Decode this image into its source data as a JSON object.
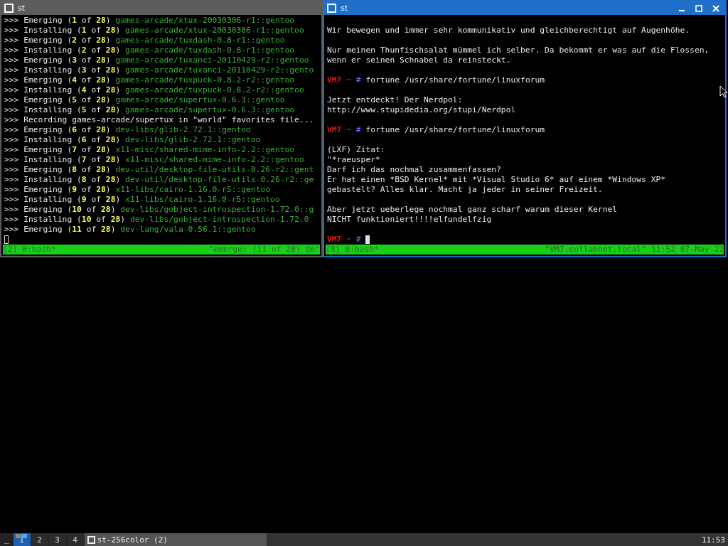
{
  "windows": [
    {
      "title": "st",
      "focused": false,
      "lines": [
        {
          "kind": "emerge",
          "parts": [
            {
              "kind": "plain",
              "text": ">>> Emerging ("
            },
            {
              "kind": "number",
              "text": "1"
            },
            {
              "kind": "plain",
              "text": " of "
            },
            {
              "kind": "number",
              "text": "28"
            },
            {
              "kind": "plain",
              "text": ") "
            },
            {
              "kind": "package",
              "text": "games-arcade/xtux-20030306-r1::gentoo"
            }
          ]
        },
        {
          "kind": "emerge",
          "parts": [
            {
              "kind": "plain",
              "text": ">>> Installing ("
            },
            {
              "kind": "number",
              "text": "1"
            },
            {
              "kind": "plain",
              "text": " of "
            },
            {
              "kind": "number",
              "text": "28"
            },
            {
              "kind": "plain",
              "text": ") "
            },
            {
              "kind": "package",
              "text": "games-arcade/xtux-20030306-r1::gentoo"
            }
          ]
        },
        {
          "kind": "emerge",
          "parts": [
            {
              "kind": "plain",
              "text": ">>> Emerging ("
            },
            {
              "kind": "number",
              "text": "2"
            },
            {
              "kind": "plain",
              "text": " of "
            },
            {
              "kind": "number",
              "text": "28"
            },
            {
              "kind": "plain",
              "text": ") "
            },
            {
              "kind": "package",
              "text": "games-arcade/tuxdash-0.8-r1::gentoo"
            }
          ]
        },
        {
          "kind": "emerge",
          "parts": [
            {
              "kind": "plain",
              "text": ">>> Installing ("
            },
            {
              "kind": "number",
              "text": "2"
            },
            {
              "kind": "plain",
              "text": " of "
            },
            {
              "kind": "number",
              "text": "28"
            },
            {
              "kind": "plain",
              "text": ") "
            },
            {
              "kind": "package",
              "text": "games-arcade/tuxdash-0.8-r1::gentoo"
            }
          ]
        },
        {
          "kind": "emerge",
          "parts": [
            {
              "kind": "plain",
              "text": ">>> Emerging ("
            },
            {
              "kind": "number",
              "text": "3"
            },
            {
              "kind": "plain",
              "text": " of "
            },
            {
              "kind": "number",
              "text": "28"
            },
            {
              "kind": "plain",
              "text": ") "
            },
            {
              "kind": "package",
              "text": "games-arcade/tuxanci-20110429-r2::gentoo"
            }
          ]
        },
        {
          "kind": "emerge",
          "parts": [
            {
              "kind": "plain",
              "text": ">>> Installing ("
            },
            {
              "kind": "number",
              "text": "3"
            },
            {
              "kind": "plain",
              "text": " of "
            },
            {
              "kind": "number",
              "text": "28"
            },
            {
              "kind": "plain",
              "text": ") "
            },
            {
              "kind": "package",
              "text": "games-arcade/tuxanci-20110429-r2::gento"
            }
          ]
        },
        {
          "kind": "emerge",
          "parts": [
            {
              "kind": "plain",
              "text": ">>> Emerging ("
            },
            {
              "kind": "number",
              "text": "4"
            },
            {
              "kind": "plain",
              "text": " of "
            },
            {
              "kind": "number",
              "text": "28"
            },
            {
              "kind": "plain",
              "text": ") "
            },
            {
              "kind": "package",
              "text": "games-arcade/tuxpuck-0.8.2-r2::gentoo"
            }
          ]
        },
        {
          "kind": "emerge",
          "parts": [
            {
              "kind": "plain",
              "text": ">>> Installing ("
            },
            {
              "kind": "number",
              "text": "4"
            },
            {
              "kind": "plain",
              "text": " of "
            },
            {
              "kind": "number",
              "text": "28"
            },
            {
              "kind": "plain",
              "text": ") "
            },
            {
              "kind": "package",
              "text": "games-arcade/tuxpuck-0.8.2-r2::gentoo"
            }
          ]
        },
        {
          "kind": "emerge",
          "parts": [
            {
              "kind": "plain",
              "text": ">>> Emerging ("
            },
            {
              "kind": "number",
              "text": "5"
            },
            {
              "kind": "plain",
              "text": " of "
            },
            {
              "kind": "number",
              "text": "28"
            },
            {
              "kind": "plain",
              "text": ") "
            },
            {
              "kind": "package",
              "text": "games-arcade/supertux-0.6.3::gentoo"
            }
          ]
        },
        {
          "kind": "emerge",
          "parts": [
            {
              "kind": "plain",
              "text": ">>> Installing ("
            },
            {
              "kind": "number",
              "text": "5"
            },
            {
              "kind": "plain",
              "text": " of "
            },
            {
              "kind": "number",
              "text": "28"
            },
            {
              "kind": "plain",
              "text": ") "
            },
            {
              "kind": "package",
              "text": "games-arcade/supertux-0.6.3::gentoo"
            }
          ]
        },
        {
          "kind": "text",
          "text": ">>> Recording games-arcade/supertux in \"world\" favorites file..."
        },
        {
          "kind": "emerge",
          "parts": [
            {
              "kind": "plain",
              "text": ">>> Emerging ("
            },
            {
              "kind": "number",
              "text": "6"
            },
            {
              "kind": "plain",
              "text": " of "
            },
            {
              "kind": "number",
              "text": "28"
            },
            {
              "kind": "plain",
              "text": ") "
            },
            {
              "kind": "package",
              "text": "dev-libs/glib-2.72.1::gentoo"
            }
          ]
        },
        {
          "kind": "emerge",
          "parts": [
            {
              "kind": "plain",
              "text": ">>> Installing ("
            },
            {
              "kind": "number",
              "text": "6"
            },
            {
              "kind": "plain",
              "text": " of "
            },
            {
              "kind": "number",
              "text": "28"
            },
            {
              "kind": "plain",
              "text": ") "
            },
            {
              "kind": "package",
              "text": "dev-libs/glib-2.72.1::gentoo"
            }
          ]
        },
        {
          "kind": "emerge",
          "parts": [
            {
              "kind": "plain",
              "text": ">>> Emerging ("
            },
            {
              "kind": "number",
              "text": "7"
            },
            {
              "kind": "plain",
              "text": " of "
            },
            {
              "kind": "number",
              "text": "28"
            },
            {
              "kind": "plain",
              "text": ") "
            },
            {
              "kind": "package",
              "text": "x11-misc/shared-mime-info-2.2::gentoo"
            }
          ]
        },
        {
          "kind": "emerge",
          "parts": [
            {
              "kind": "plain",
              "text": ">>> Installing ("
            },
            {
              "kind": "number",
              "text": "7"
            },
            {
              "kind": "plain",
              "text": " of "
            },
            {
              "kind": "number",
              "text": "28"
            },
            {
              "kind": "plain",
              "text": ") "
            },
            {
              "kind": "package",
              "text": "x11-misc/shared-mime-info-2.2::gentoo"
            }
          ]
        },
        {
          "kind": "emerge",
          "parts": [
            {
              "kind": "plain",
              "text": ">>> Emerging ("
            },
            {
              "kind": "number",
              "text": "8"
            },
            {
              "kind": "plain",
              "text": " of "
            },
            {
              "kind": "number",
              "text": "28"
            },
            {
              "kind": "plain",
              "text": ") "
            },
            {
              "kind": "package",
              "text": "dev-util/desktop-file-utils-0.26-r2::gent"
            }
          ]
        },
        {
          "kind": "emerge",
          "parts": [
            {
              "kind": "plain",
              "text": ">>> Installing ("
            },
            {
              "kind": "number",
              "text": "8"
            },
            {
              "kind": "plain",
              "text": " of "
            },
            {
              "kind": "number",
              "text": "28"
            },
            {
              "kind": "plain",
              "text": ") "
            },
            {
              "kind": "package",
              "text": "dev-util/desktop-file-utils-0.26-r2::ge"
            }
          ]
        },
        {
          "kind": "emerge",
          "parts": [
            {
              "kind": "plain",
              "text": ">>> Emerging ("
            },
            {
              "kind": "number",
              "text": "9"
            },
            {
              "kind": "plain",
              "text": " of "
            },
            {
              "kind": "number",
              "text": "28"
            },
            {
              "kind": "plain",
              "text": ") "
            },
            {
              "kind": "package",
              "text": "x11-libs/cairo-1.16.0-r5::gentoo"
            }
          ]
        },
        {
          "kind": "emerge",
          "parts": [
            {
              "kind": "plain",
              "text": ">>> Installing ("
            },
            {
              "kind": "number",
              "text": "9"
            },
            {
              "kind": "plain",
              "text": " of "
            },
            {
              "kind": "number",
              "text": "28"
            },
            {
              "kind": "plain",
              "text": ") "
            },
            {
              "kind": "package",
              "text": "x11-libs/cairo-1.16.0-r5::gentoo"
            }
          ]
        },
        {
          "kind": "emerge",
          "parts": [
            {
              "kind": "plain",
              "text": ">>> Emerging ("
            },
            {
              "kind": "number",
              "text": "10"
            },
            {
              "kind": "plain",
              "text": " of "
            },
            {
              "kind": "number",
              "text": "28"
            },
            {
              "kind": "plain",
              "text": ") "
            },
            {
              "kind": "package",
              "text": "dev-libs/gobject-introspection-1.72.0::g"
            }
          ]
        },
        {
          "kind": "emerge",
          "parts": [
            {
              "kind": "plain",
              "text": ">>> Installing ("
            },
            {
              "kind": "number",
              "text": "10"
            },
            {
              "kind": "plain",
              "text": " of "
            },
            {
              "kind": "number",
              "text": "28"
            },
            {
              "kind": "plain",
              "text": ") "
            },
            {
              "kind": "package",
              "text": "dev-libs/gobject-introspection-1.72.0"
            }
          ]
        },
        {
          "kind": "emerge",
          "parts": [
            {
              "kind": "plain",
              "text": ">>> Emerging ("
            },
            {
              "kind": "number",
              "text": "11"
            },
            {
              "kind": "plain",
              "text": " of "
            },
            {
              "kind": "number",
              "text": "28"
            },
            {
              "kind": "plain",
              "text": ") "
            },
            {
              "kind": "package",
              "text": "dev-lang/vala-0.56.1::gentoo"
            }
          ]
        },
        {
          "kind": "cursor"
        }
      ],
      "status_left": "[2] 0:bash*",
      "status_right": "\"emerge: (11 of 28) de\""
    },
    {
      "title": "st",
      "focused": true,
      "controls": [
        {
          "kind": "minimize"
        },
        {
          "kind": "maximize"
        },
        {
          "kind": "close"
        }
      ],
      "lines": [
        {
          "kind": "blank"
        },
        {
          "kind": "text",
          "text": "Wir bewegen und immer sehr kommunikativ und gleichberechtigt auf Augenhöhe."
        },
        {
          "kind": "blank"
        },
        {
          "kind": "text",
          "text": "Nur meinen Thunfischsalat mümmel ich selber. Da bekommt er was auf die Flossen,"
        },
        {
          "kind": "text",
          "text": "wenn er seinen Schnabel da reinsteckt."
        },
        {
          "kind": "blank"
        },
        {
          "kind": "prompt",
          "host": "VM7",
          "path": "~",
          "symbol": "#",
          "command": "fortune /usr/share/fortune/linuxforum"
        },
        {
          "kind": "blank"
        },
        {
          "kind": "text",
          "text": "Jetzt entdeckt! Der Nerdpol:"
        },
        {
          "kind": "text",
          "text": "http://www.stupidedia.org/stupi/Nerdpol"
        },
        {
          "kind": "blank"
        },
        {
          "kind": "prompt",
          "host": "VM7",
          "path": "~",
          "symbol": "#",
          "command": "fortune /usr/share/fortune/linuxforum"
        },
        {
          "kind": "blank"
        },
        {
          "kind": "text",
          "text": "(LXF) Zitat:"
        },
        {
          "kind": "text",
          "text": "\"*raeusper*"
        },
        {
          "kind": "text",
          "text": "Darf ich das nochmal zusammenfassen?"
        },
        {
          "kind": "text",
          "text": "Er hat einen *BSD Kernel* mit *Visual Studio 6* auf einem *Windows XP*"
        },
        {
          "kind": "text",
          "text": "gebastelt? Alles klar. Macht ja jeder in seiner Freizeit."
        },
        {
          "kind": "blank"
        },
        {
          "kind": "text",
          "text": "Aber jetzt ueberlege nochmal ganz scharf warum dieser Kernel"
        },
        {
          "kind": "text",
          "text": "NICHT funktioniert!!!!elfundelfzig"
        },
        {
          "kind": "blank"
        },
        {
          "kind": "prompt",
          "host": "VM7",
          "path": "~",
          "symbol": "#",
          "cursor": true
        }
      ],
      "status_left": "[8] 0:bash*",
      "status_right": "\"VM7.collabnet.local\" 11:52 07-May-22"
    }
  ],
  "taskbar": {
    "layout_symbol": "_",
    "tags": [
      {
        "label": "1",
        "selected": true
      },
      {
        "label": "2",
        "selected": false
      },
      {
        "label": "3",
        "selected": false
      },
      {
        "label": "4",
        "selected": false
      }
    ],
    "task": {
      "title": "st-256color (2)"
    },
    "clock": "11:53"
  }
}
